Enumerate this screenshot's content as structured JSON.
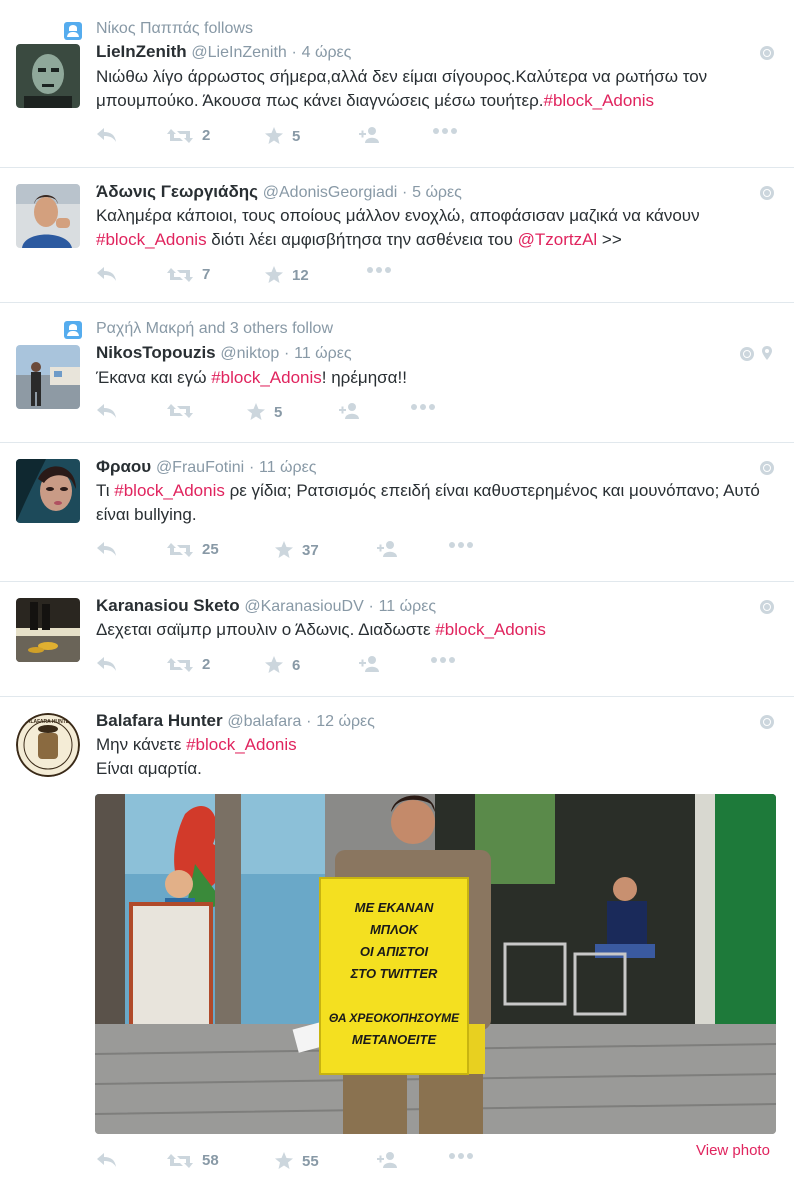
{
  "tweets": [
    {
      "context": "Νίκος Παππάς follows",
      "name": "LieInZenith",
      "handle": "@LieInZenith",
      "time": "4 ώρες",
      "text_parts": [
        "Νιώθω λίγο άρρωστος σήμερα,αλλά δεν είμαι σίγουρος.Καλύτερα να ρωτήσω τον μπουμπούκο. Άκουσα πως κάνει διαγνώσεις μέσω τουήτερ.",
        "#block_Adonis"
      ],
      "retweets": "2",
      "favorites": "5"
    },
    {
      "name": "Άδωνις Γεωργιάδης",
      "handle": "@AdonisGeorgiadi",
      "time": "5 ώρες",
      "text_parts": [
        "Καλημέρα κάποιοι, τους οποίους μάλλον ενοχλώ, αποφάσισαν μαζικά να κάνουν ",
        "#block_Adonis",
        " διότι λέει αμφισβήτησα την ασθένεια του ",
        "@TzortzAl",
        " >>"
      ],
      "retweets": "7",
      "favorites": "12"
    },
    {
      "context": "Ραχήλ Μακρή and 3 others follow",
      "name": "NikosTopouzis",
      "handle": "@niktop",
      "time": "11 ώρες",
      "text_parts": [
        "Έκανα και εγώ ",
        "#block_Adonis",
        "! ηρέμησα!!"
      ],
      "retweets": "",
      "favorites": "5"
    },
    {
      "name": "Φραου",
      "handle": "@FrauFotini",
      "time": "11 ώρες",
      "text_parts": [
        "Τι ",
        "#block_Adonis",
        " ρε γίδια; Ρατσισμός επειδή είναι καθυστερημένος και μουνόπανο; Αυτό είναι bullying."
      ],
      "retweets": "25",
      "favorites": "37"
    },
    {
      "name": "Karanasiou Sketo",
      "handle": "@KaranasiouDV",
      "time": "11 ώρες",
      "text_parts": [
        "Δεχεται σαϊμπρ μπουλιν ο Άδωνις. Διαδωστε ",
        "#block_Adonis"
      ],
      "retweets": "2",
      "favorites": "6"
    },
    {
      "name": "Balafara Hunter",
      "handle": "@balafara",
      "time": "12 ώρες",
      "text_parts": [
        "Μην κάνετε ",
        "#block_Adonis",
        "Είναι αμαρτία."
      ],
      "retweets": "58",
      "favorites": "55",
      "view_photo": "View photo",
      "sign_lines": [
        "ΜΕ ΕΚΑΝΑΝ",
        "ΜΠΛΟΚ",
        "ΟΙ ΑΠΙΣΤΟΙ",
        "ΣΤΟ TWITTER",
        "ΘΑ ΧΡΕΟΚΟΠΗΣΟΥΜΕ",
        "ΜΕΤΑΝΟΕΙΤΕ"
      ],
      "avatar_text": "BALAFARA HUNTER"
    }
  ],
  "dot": "·",
  "colors": {
    "accent": "#e0245e",
    "muted": "#8899a6",
    "link": "#55acee"
  }
}
